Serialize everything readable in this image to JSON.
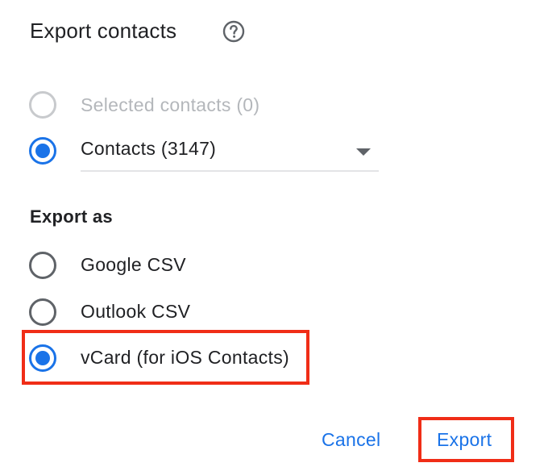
{
  "dialog": {
    "title": "Export contacts",
    "help_icon": "help-circle-icon"
  },
  "scope": {
    "options": [
      {
        "label": "Selected contacts (0)",
        "selected": false,
        "disabled": true
      },
      {
        "label": "Contacts (3147)",
        "selected": true,
        "disabled": false
      }
    ],
    "select": {
      "value": "Contacts (3147)",
      "icon": "dropdown-arrow-icon"
    }
  },
  "export_as": {
    "heading": "Export as",
    "options": [
      {
        "label": "Google CSV",
        "selected": false
      },
      {
        "label": "Outlook CSV",
        "selected": false
      },
      {
        "label": "vCard (for iOS Contacts)",
        "selected": true
      }
    ]
  },
  "actions": {
    "cancel_label": "Cancel",
    "export_label": "Export"
  },
  "colors": {
    "accent": "#1a73e8",
    "highlight": "#f02d17",
    "disabled": "#b4b7bb",
    "radio_unchecked": "#5f6368"
  }
}
